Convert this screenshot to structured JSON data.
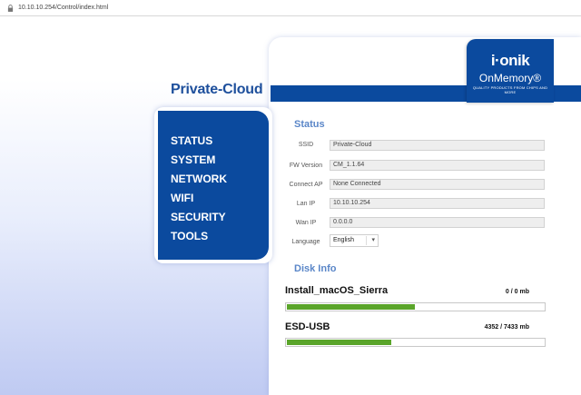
{
  "browser": {
    "url": "10.10.10.254/Control/index.html"
  },
  "header": {
    "title": "Private-Cloud"
  },
  "logo": {
    "brand": "i·onik",
    "product": "OnMemory®",
    "tagline": "QUALITY PRODUCTS FROM CHIPS AND MORE"
  },
  "nav": {
    "items": [
      {
        "label": "STATUS"
      },
      {
        "label": "SYSTEM"
      },
      {
        "label": "NETWORK"
      },
      {
        "label": "WIFI"
      },
      {
        "label": "SECURITY"
      },
      {
        "label": "TOOLS"
      }
    ]
  },
  "status": {
    "title": "Status",
    "rows": [
      {
        "label": "SSID",
        "value": "Private-Cloud"
      },
      {
        "label": "FW Version",
        "value": "CM_1.1.64"
      },
      {
        "label": "Connect AP",
        "value": "None Connected"
      },
      {
        "label": "Lan IP",
        "value": "10.10.10.254"
      },
      {
        "label": "Wan IP",
        "value": "0.0.0.0"
      }
    ],
    "language": {
      "label": "Language",
      "value": "English"
    }
  },
  "disk": {
    "title": "Disk Info",
    "drives": [
      {
        "name": "Install_macOS_Sierra",
        "usage": "0 / 0 mb",
        "fill_fraction": 0.5
      },
      {
        "name": "ESD-USB",
        "usage": "4352 / 7433 mb",
        "fill_fraction": 0.41
      }
    ]
  },
  "colors": {
    "accent": "#0b4a9e",
    "bar": "#5aa52a",
    "section": "#5a86c8"
  }
}
